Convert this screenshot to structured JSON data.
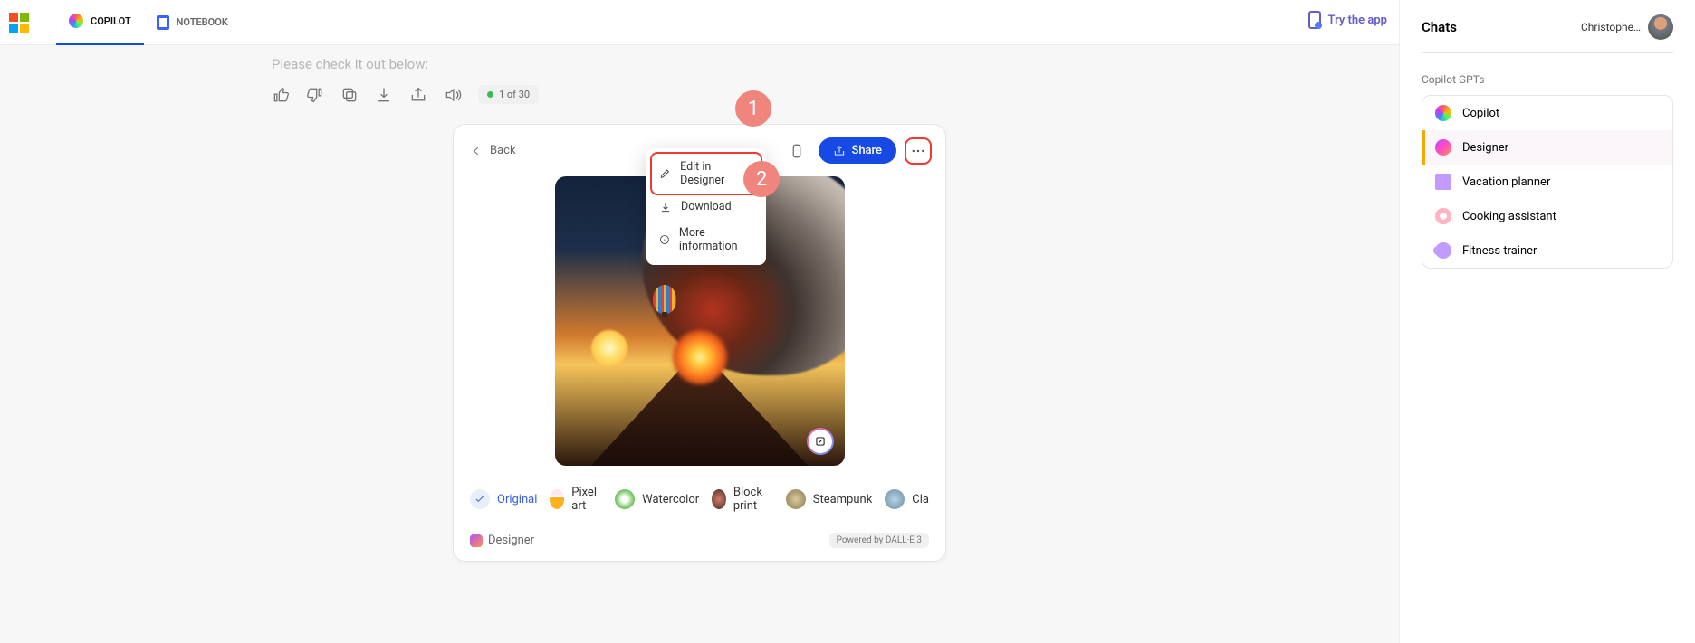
{
  "topnav": {
    "tabs": [
      {
        "label": "COPILOT",
        "active": true
      },
      {
        "label": "NOTEBOOK",
        "active": false
      }
    ],
    "try_app": "Try the app"
  },
  "sidebar": {
    "title": "Chats",
    "user_name": "Christophe…",
    "gpts_label": "Copilot GPTs",
    "items": [
      {
        "label": "Copilot"
      },
      {
        "label": "Designer"
      },
      {
        "label": "Vacation planner"
      },
      {
        "label": "Cooking assistant"
      },
      {
        "label": "Fitness trainer"
      }
    ]
  },
  "main": {
    "prompt_tail": "Please check it out below:",
    "counter": "1 of 30",
    "back_label": "Back",
    "share_label": "Share",
    "dropdown": {
      "edit": "Edit in Designer",
      "download": "Download",
      "more_info": "More information"
    },
    "styles": [
      {
        "label": "Original",
        "selected": true
      },
      {
        "label": "Pixel art"
      },
      {
        "label": "Watercolor"
      },
      {
        "label": "Block print"
      },
      {
        "label": "Steampunk"
      },
      {
        "label": "Cla"
      }
    ],
    "footer": {
      "brand": "Designer",
      "powered": "Powered by DALL·E 3"
    }
  },
  "annotations": {
    "step1": "1",
    "step2": "2"
  }
}
